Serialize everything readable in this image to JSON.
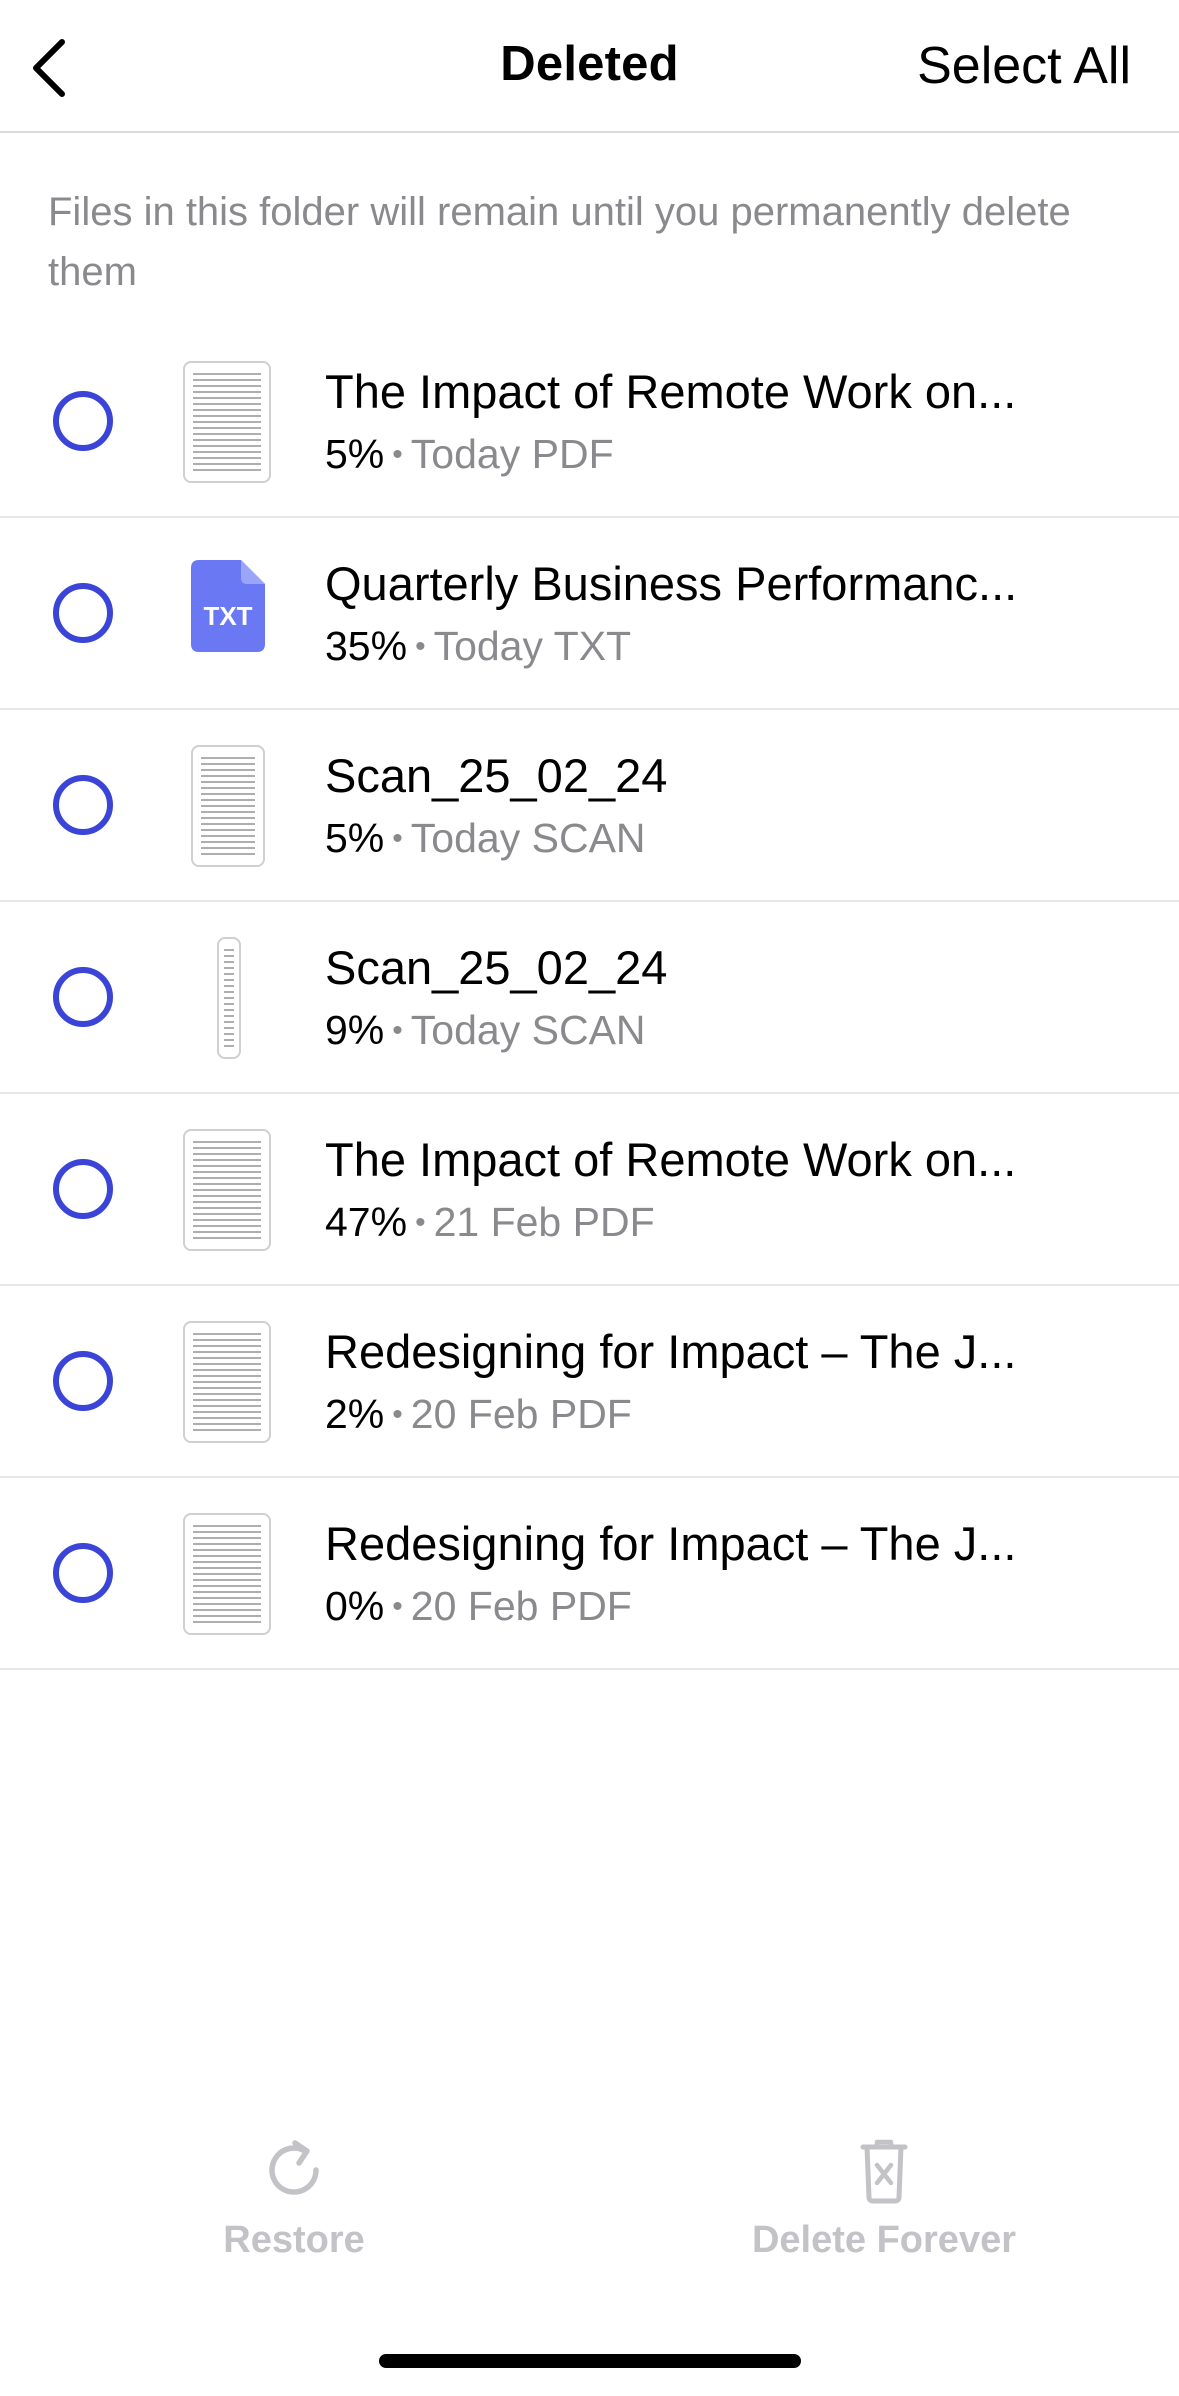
{
  "header": {
    "back_icon": "chevron-left-icon",
    "title": "Deleted",
    "select_all_label": "Select All"
  },
  "info_text": "Files in this folder will remain until you permanently delete them",
  "files": [
    {
      "title": "The Impact of Remote Work on...",
      "percent": "5%",
      "date": "Today",
      "type": "PDF",
      "thumb": "document"
    },
    {
      "title": "Quarterly Business Performanc...",
      "percent": "35%",
      "date": "Today",
      "type": "TXT",
      "thumb": "txt",
      "thumb_label": "TXT"
    },
    {
      "title": "Scan_25_02_24",
      "percent": "5%",
      "date": "Today",
      "type": "SCAN",
      "thumb": "scan"
    },
    {
      "title": "Scan_25_02_24",
      "percent": "9%",
      "date": "Today",
      "type": "SCAN",
      "thumb": "scan-narrow"
    },
    {
      "title": "The Impact of Remote Work on...",
      "percent": "47%",
      "date": "21 Feb",
      "type": "PDF",
      "thumb": "document"
    },
    {
      "title": "Redesigning for Impact – The J...",
      "percent": "2%",
      "date": "20 Feb",
      "type": "PDF",
      "thumb": "document"
    },
    {
      "title": "Redesigning for Impact – The J...",
      "percent": "0%",
      "date": "20 Feb",
      "type": "PDF",
      "thumb": "document"
    }
  ],
  "meta_separator": "•",
  "toolbar": {
    "restore_label": "Restore",
    "restore_icon": "restore-icon",
    "delete_label": "Delete Forever",
    "delete_icon": "trash-x-icon"
  },
  "colors": {
    "accent": "#3a44d6",
    "txt_icon": "#6a78f4",
    "secondary_text": "#8a8a8e",
    "disabled": "#c2c2c7"
  }
}
